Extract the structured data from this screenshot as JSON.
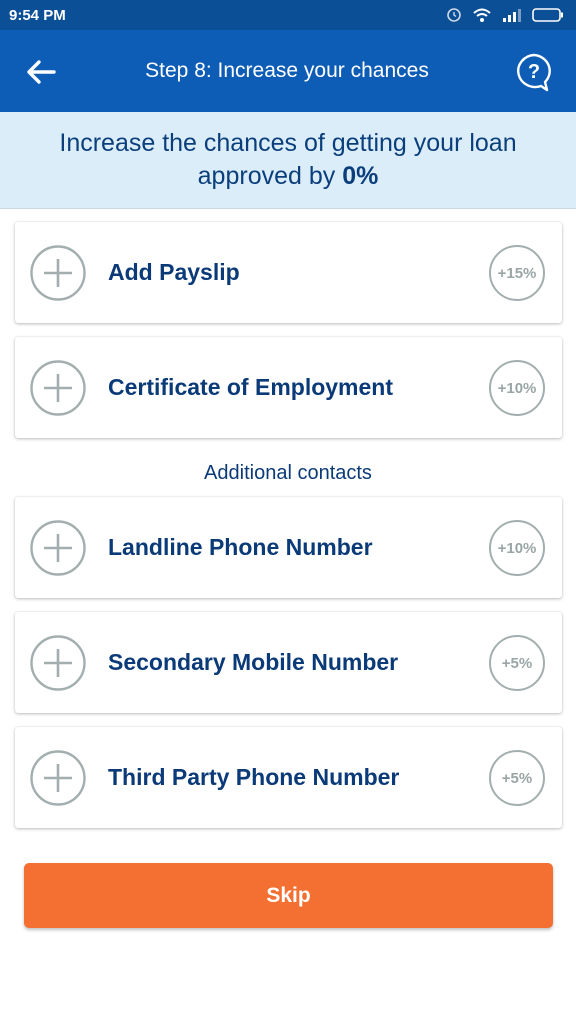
{
  "status_bar": {
    "time": "9:54 PM",
    "icons": [
      "alarm-icon",
      "wifi-icon",
      "signal-icon",
      "battery-icon"
    ]
  },
  "app_bar": {
    "title": "Step 8: Increase your chances",
    "back_icon": "back-arrow-icon",
    "help_icon": "help-bubble-icon"
  },
  "banner": {
    "line1": "Increase the chances of getting your loan",
    "line2_prefix": "approved by ",
    "percent": "0%"
  },
  "documents": [
    {
      "label": "Add Payslip",
      "bonus": "+15%"
    },
    {
      "label": "Certificate of Employment",
      "bonus": "+10%"
    }
  ],
  "additional_contacts_heading": "Additional contacts",
  "contacts": [
    {
      "label": "Landline Phone Number",
      "bonus": "+10%"
    },
    {
      "label": "Secondary Mobile Number",
      "bonus": "+5%"
    },
    {
      "label": "Third Party Phone Number",
      "bonus": "+5%"
    }
  ],
  "skip_label": "Skip",
  "colors": {
    "status_bar": "#0b4f96",
    "app_bar": "#0d5cb5",
    "banner_bg": "#dcedfa",
    "text_primary": "#0b3a78",
    "skip_button": "#f36f32",
    "circle_grey": "#a3aeae"
  }
}
